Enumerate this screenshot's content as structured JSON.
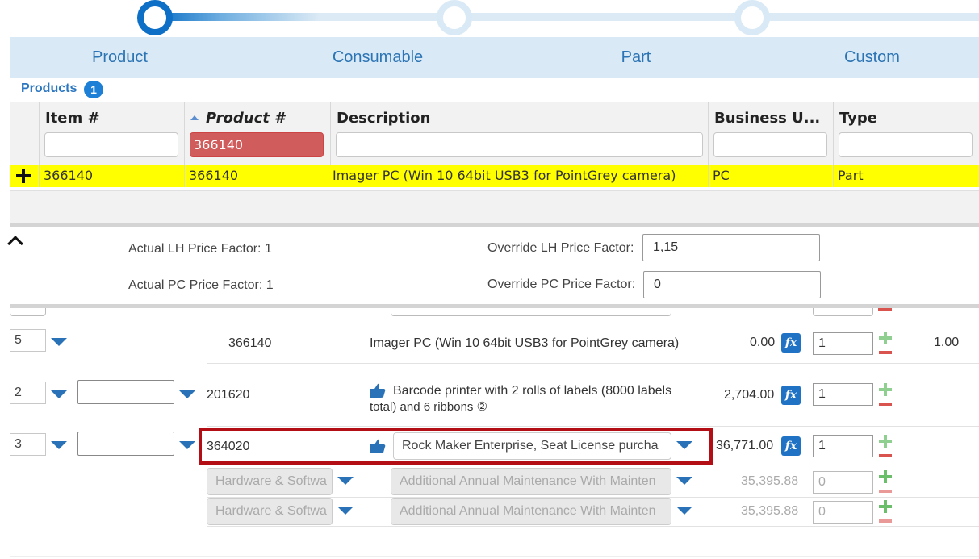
{
  "steps": [
    {
      "name": "step-1",
      "state": "active"
    },
    {
      "name": "step-2",
      "state": "inactive"
    },
    {
      "name": "step-3",
      "state": "inactive"
    }
  ],
  "tabs": [
    "Product",
    "Consumable",
    "Part",
    "Custom"
  ],
  "products": {
    "label": "Products",
    "count": "1"
  },
  "grid": {
    "columns": [
      "Item #",
      "Product #",
      "Description",
      "Business U...",
      "Type"
    ],
    "filters": {
      "product": "366140"
    },
    "row": {
      "item": "366140",
      "product": "366140",
      "description": "Imager PC (Win 10 64bit USB3 for PointGrey camera)",
      "business_unit": "PC",
      "type": "Part"
    }
  },
  "factors": {
    "actual_lh_label": "Actual LH Price Factor: 1",
    "actual_pc_label": "Actual PC Price Factor: 1",
    "override_lh_label": "Override LH Price Factor:",
    "override_lh_value": "1,15",
    "override_pc_label": "Override PC Price Factor:",
    "override_pc_value": "0"
  },
  "lines": [
    {
      "pos": "5",
      "product": "366140",
      "description": "Imager PC (Win 10 64bit USB3 for PointGrey camera)",
      "price": "0.00",
      "qty": "1",
      "extra": "1.00"
    },
    {
      "pos": "2",
      "product": "201620",
      "description_line1": "Barcode printer with 2 rolls of labels (8000 labels",
      "description_line2": "total) and 6 ribbons ②",
      "price": "2,704.00",
      "qty": "1"
    },
    {
      "pos": "3",
      "product": "364020",
      "description": "Rock Maker Enterprise, Seat License purcha",
      "price": "36,771.00",
      "qty": "1"
    },
    {
      "category": "Hardware & Softwa",
      "description": "Additional Annual Maintenance With Mainten",
      "price": "35,395.88",
      "qty": "0"
    },
    {
      "category": "Hardware & Softwa",
      "description": "Additional Annual Maintenance With Mainten",
      "price": "35,395.88",
      "qty": "0"
    }
  ],
  "colors": {
    "accent": "#1e7fd6",
    "highlight_row": "#ffff00",
    "filter_active": "#d05c5c",
    "selection_border": "#b30d15"
  },
  "icons": [
    "chevron-up-icon",
    "plus-icon",
    "dropdown-arrow-icon",
    "fx-icon",
    "thumbs-up-icon",
    "add-icon",
    "remove-icon"
  ]
}
